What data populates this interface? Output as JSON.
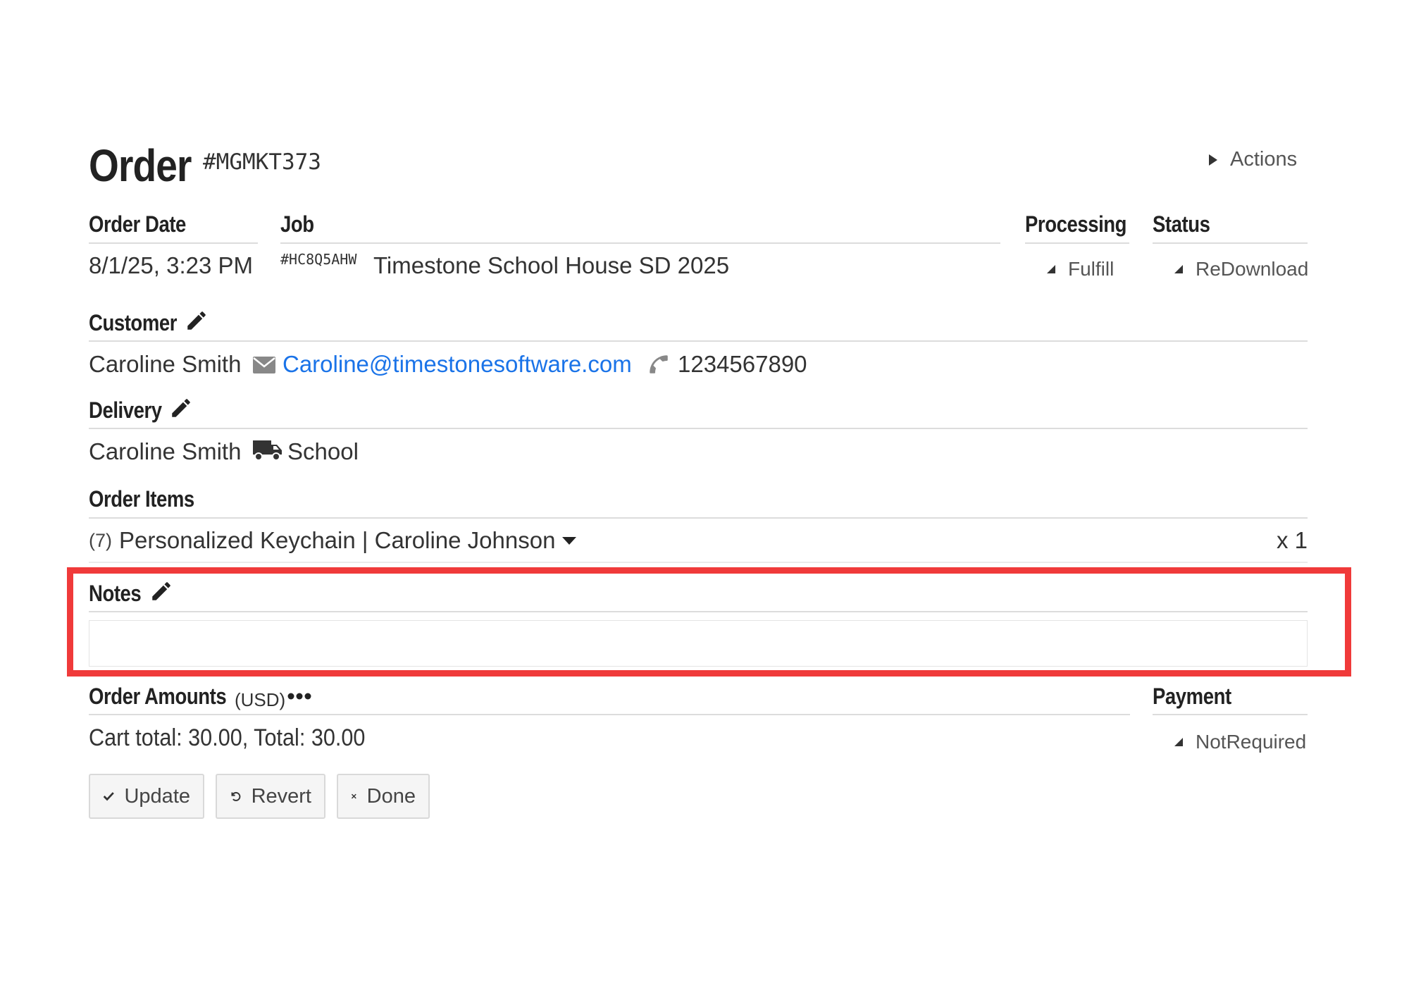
{
  "header": {
    "title": "Order",
    "order_id": "#MGMKT373",
    "actions_label": "Actions"
  },
  "order_date": {
    "label": "Order Date",
    "value": "8/1/25, 3:23 PM"
  },
  "job": {
    "label": "Job",
    "code": "#HC8Q5AHW",
    "name": "Timestone School House SD 2025"
  },
  "processing": {
    "label": "Processing",
    "value": "Fulfill"
  },
  "status": {
    "label": "Status",
    "value": "ReDownload"
  },
  "customer": {
    "label": "Customer",
    "name": "Caroline Smith",
    "email": "Caroline@timestonesoftware.com",
    "phone": "1234567890"
  },
  "delivery": {
    "label": "Delivery",
    "name": "Caroline Smith",
    "method": "School"
  },
  "order_items": {
    "label": "Order Items",
    "items": [
      {
        "count": "(7)",
        "description": "Personalized Keychain | Caroline Johnson",
        "quantity": "x 1"
      }
    ]
  },
  "notes": {
    "label": "Notes",
    "value": ""
  },
  "order_amounts": {
    "label": "Order Amounts",
    "currency": "(USD)",
    "summary": "Cart total: 30.00,  Total: 30.00"
  },
  "payment": {
    "label": "Payment",
    "value": "NotRequired"
  },
  "buttons": {
    "update": "Update",
    "revert": "Revert",
    "done": "Done"
  },
  "colors": {
    "highlight": "#f03a3a",
    "link": "#1a73e8"
  }
}
